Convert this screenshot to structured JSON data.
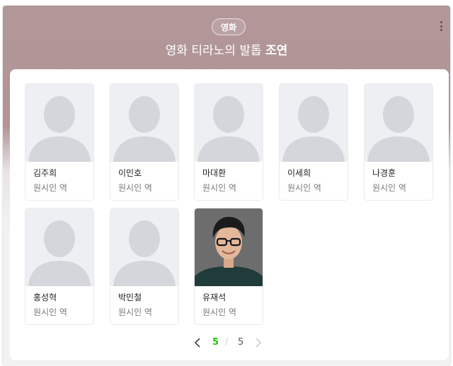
{
  "header": {
    "category": "영화",
    "title_main": "영화 티라노의 발톱",
    "title_section": "조연"
  },
  "cast": [
    {
      "name": "김주희",
      "role": "원시인 역",
      "photo": "placeholder-silhouette"
    },
    {
      "name": "이민호",
      "role": "원시인 역",
      "photo": "placeholder-silhouette"
    },
    {
      "name": "마대환",
      "role": "원시인 역",
      "photo": "placeholder-silhouette"
    },
    {
      "name": "이세희",
      "role": "원시인 역",
      "photo": "placeholder-silhouette"
    },
    {
      "name": "나경훈",
      "role": "원시인 역",
      "photo": "placeholder-silhouette"
    },
    {
      "name": "홍성혁",
      "role": "원시인 역",
      "photo": "placeholder-silhouette"
    },
    {
      "name": "박민철",
      "role": "원시인 역",
      "photo": "placeholder-silhouette"
    },
    {
      "name": "유재석",
      "role": "원시인 역",
      "photo": "portrait-photo"
    }
  ],
  "pagination": {
    "current": "5",
    "separator": "/",
    "total": "5"
  },
  "colors": {
    "header_bg": "#b29799",
    "pager_active": "#1ec800"
  },
  "icons": [
    "more-vertical-icon",
    "chevron-left-icon",
    "chevron-right-icon",
    "person-silhouette-icon"
  ]
}
